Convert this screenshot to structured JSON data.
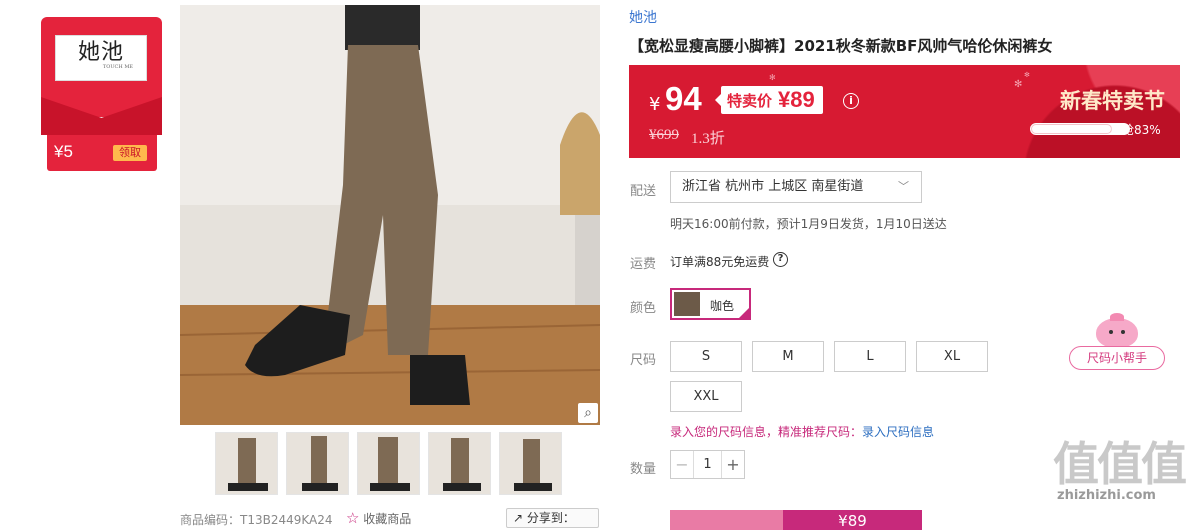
{
  "coupon": {
    "logo_cn": "她池",
    "logo_en": "TOUCH ME",
    "amount": "¥5",
    "get_label": "领取"
  },
  "gallery": {
    "thumb_count": 5
  },
  "sku_text": "商品编码：T13B2449KA24",
  "favorite_label": "收藏商品",
  "share_label": "分享到：",
  "brand": "她池",
  "title": "【宽松显瘦高腰小脚裤】2021秋冬新款BF风帅气哈伦休闲裤女",
  "price": {
    "yen": "¥",
    "main": "94",
    "sale_label": "特卖价",
    "sale_price": "¥89",
    "original": "¥699",
    "discount": "1.3折",
    "festival": "新春特卖节",
    "sold_text": "已抢83%",
    "sold_fraction": 0.83
  },
  "shipping": {
    "label": "配送",
    "address": "浙江省 杭州市 上城区 南星街道",
    "time_text": "明天16:00前付款，预计1月9日发货，1月10日送达"
  },
  "fee": {
    "label": "运费",
    "text": "订单满88元免运费"
  },
  "color": {
    "label": "颜色",
    "selected": "咖色"
  },
  "size": {
    "label": "尺码",
    "options": [
      "S",
      "M",
      "L",
      "XL",
      "XXL"
    ]
  },
  "size_tip": {
    "prefix": "录入您的尺码信息，精准推荐尺码：",
    "link": "录入尺码信息"
  },
  "size_helper": "尺码小帮手",
  "quantity": {
    "label": "数量",
    "value": "1",
    "minus": "−",
    "plus": "+"
  },
  "buy_price": "¥89",
  "watermark": {
    "big": "值值值",
    "url": "zhizhizhi.com"
  },
  "colors": {
    "brand_red": "#d71a32",
    "accent_pink": "#c7297b",
    "link_blue": "#3b76d0"
  }
}
